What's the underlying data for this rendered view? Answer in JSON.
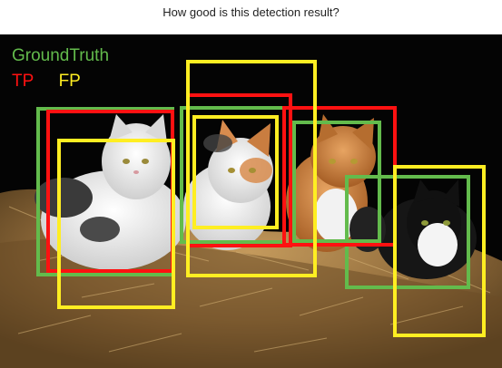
{
  "question": "How good is this detection result?",
  "legend": {
    "ground_truth": {
      "label": "GroundTruth",
      "color": "#63bb4c"
    },
    "tp": {
      "label": "TP",
      "color": "#ff1111"
    },
    "fp": {
      "label": "FP",
      "color": "#ffee22"
    }
  },
  "scene": {
    "subject": "five cats sitting on a hay bale",
    "background": "black"
  }
}
